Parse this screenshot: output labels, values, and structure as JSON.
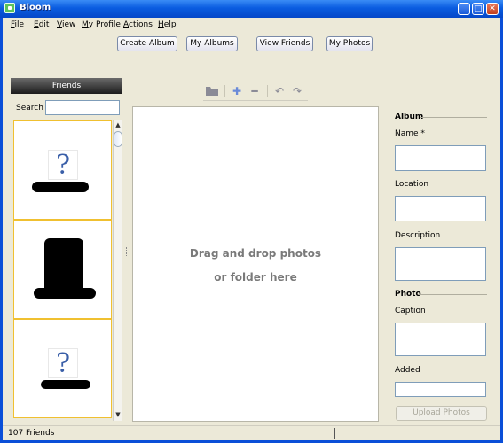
{
  "window": {
    "title": "Bloom"
  },
  "menu": [
    {
      "label": "File",
      "ul": "F"
    },
    {
      "label": "Edit",
      "ul": "E"
    },
    {
      "label": "View",
      "ul": "V"
    },
    {
      "label": "My Profile",
      "ul": "M"
    },
    {
      "label": "Actions",
      "ul": "A"
    },
    {
      "label": "Help",
      "ul": "H"
    }
  ],
  "top_buttons": {
    "create_album": "Create Album",
    "my_albums": "My Albums",
    "view_friends": "View Friends",
    "my_photos": "My Photos"
  },
  "friends_panel": {
    "header": "Friends",
    "search_label": "Search",
    "search_value": ""
  },
  "toolbar": {
    "icons": [
      "folder-icon",
      "add-icon",
      "remove-icon",
      "rotate-left-icon",
      "rotate-right-icon"
    ]
  },
  "drop_area": {
    "line1": "Drag and drop photos",
    "line2": "or folder here"
  },
  "album_form": {
    "album_title": "Album",
    "name_label": "Name *",
    "location_label": "Location",
    "description_label": "Description",
    "photo_title": "Photo",
    "caption_label": "Caption",
    "added_label": "Added",
    "upload_button": "Upload Photos"
  },
  "status": {
    "friends_count": "107 Friends"
  },
  "colors": {
    "title_bar": "#0a5ce0",
    "selection_border": "#f0c030",
    "window_bg": "#ECE9D8"
  }
}
